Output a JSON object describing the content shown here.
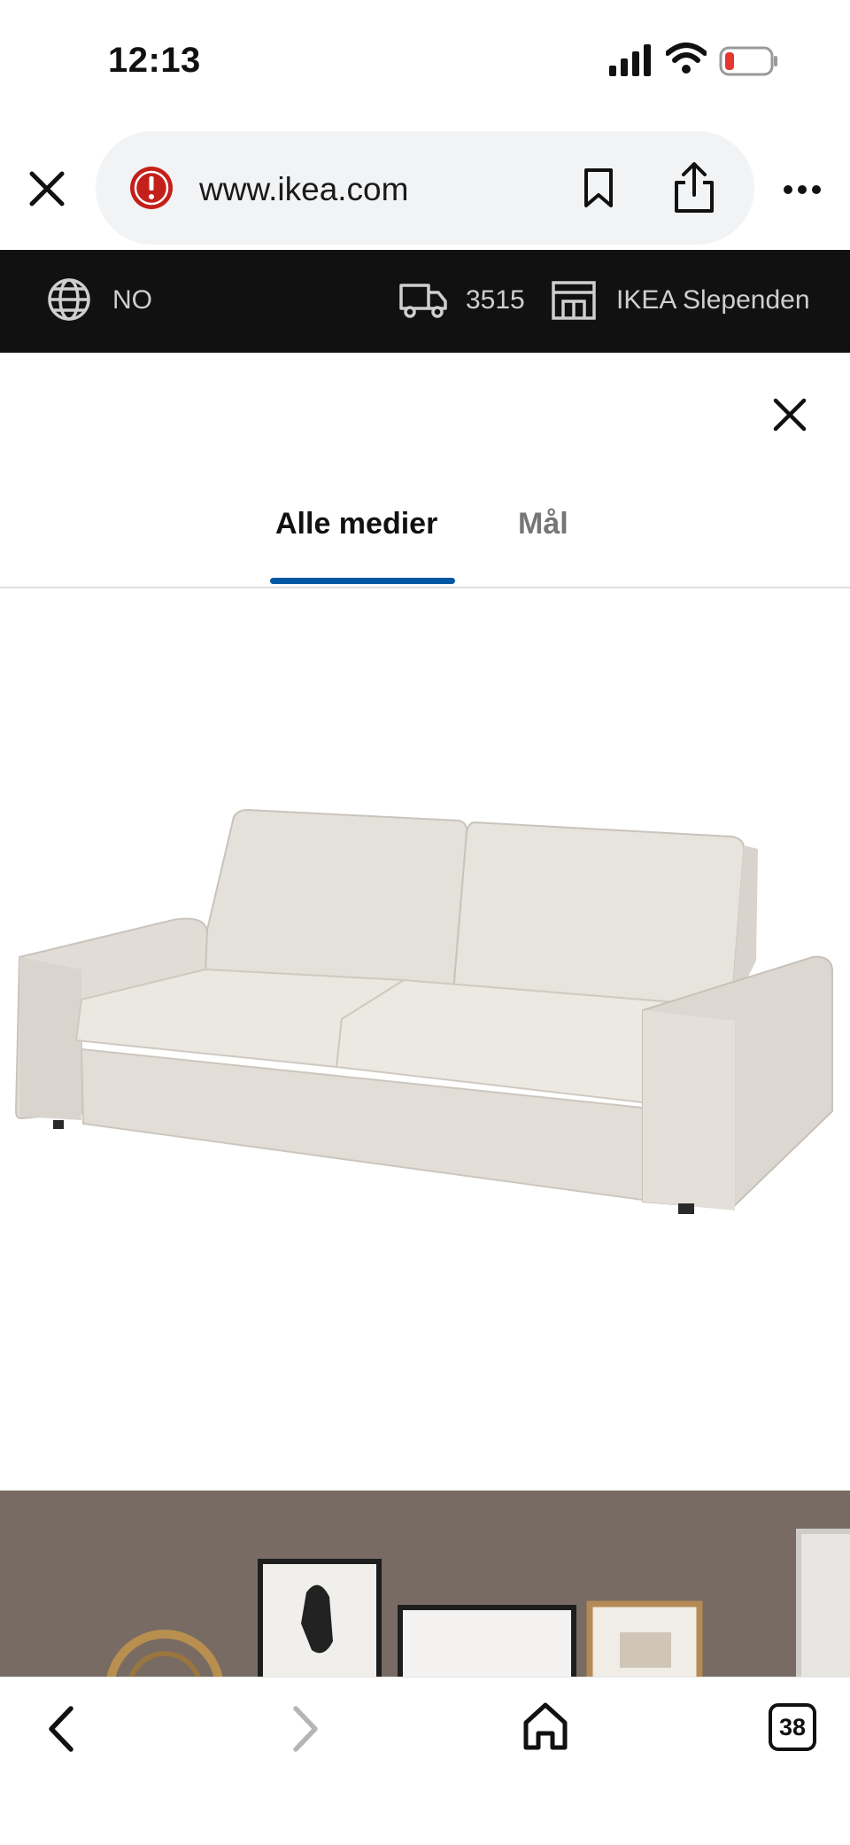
{
  "status_bar": {
    "time": "12:13",
    "icons": [
      "cellular-signal-icon",
      "wifi-icon",
      "battery-low-icon"
    ],
    "battery_color": "#e5372f"
  },
  "browser": {
    "url": "www.ikea.com",
    "icons": [
      "close-icon",
      "security-warning-icon",
      "bookmark-icon",
      "share-icon",
      "more-icon"
    ],
    "warning_color": "#c4201a"
  },
  "ikea_header": {
    "language": "NO",
    "postcode": "3515",
    "store": "IKEA Slependen",
    "icons": [
      "globe-icon",
      "delivery-truck-icon",
      "store-icon"
    ]
  },
  "media_sheet": {
    "tabs": [
      {
        "label": "Alle medier",
        "active": true
      },
      {
        "label": "Mål",
        "active": false
      }
    ],
    "accent_color": "#0058a3",
    "images": [
      "sofa-product-image",
      "room-scene-image"
    ]
  },
  "bottom_toolbar": {
    "open_tabs_count": "38",
    "icons": [
      "back-arrow-icon",
      "forward-arrow-icon",
      "home-icon",
      "tabs-icon"
    ]
  }
}
